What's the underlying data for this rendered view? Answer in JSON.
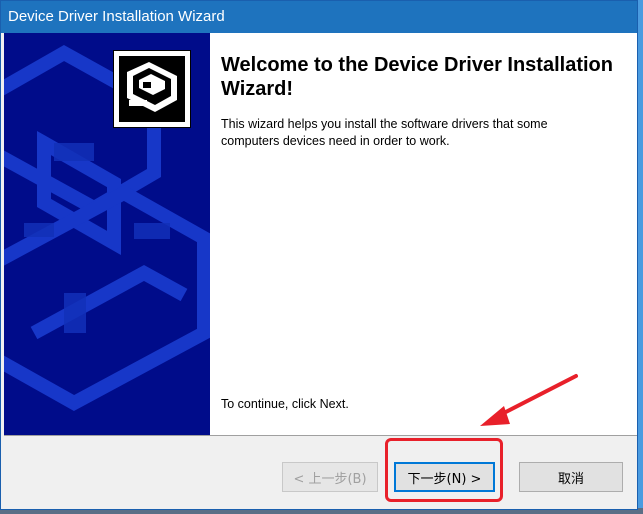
{
  "window": {
    "title": "Device Driver Installation Wizard"
  },
  "content": {
    "heading": "Welcome to the Device Driver Installation Wizard!",
    "description": "This wizard helps you install the software drivers that some computers devices need in order to work.",
    "continue_text": "To continue, click Next."
  },
  "buttons": {
    "back_label": "< 上一步(B)",
    "next_label": "下一步(N) >",
    "cancel_label": "取消"
  },
  "colors": {
    "titlebar": "#1e73be",
    "banner": "#000c8a",
    "annotation": "#e8202a"
  }
}
